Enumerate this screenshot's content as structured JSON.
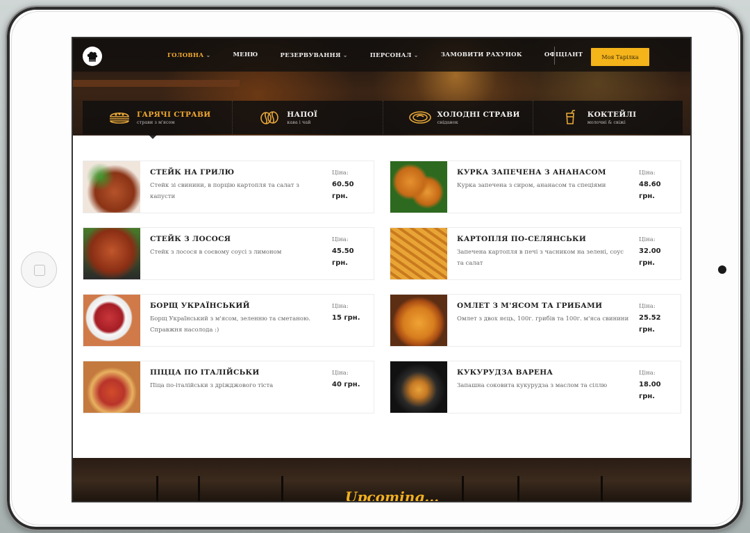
{
  "nav": {
    "items": [
      {
        "label": "ГОЛОВНА",
        "caret": "⌄",
        "active": true
      },
      {
        "label": "МЕНЮ",
        "caret": "",
        "active": false
      },
      {
        "label": "РЕЗЕРВУВАННЯ",
        "caret": "⌄",
        "active": false
      },
      {
        "label": "ПЕРСОНАЛ",
        "caret": "⌄",
        "active": false
      },
      {
        "label": "ЗАМОВИТИ РАХУНОК",
        "caret": "",
        "active": false
      },
      {
        "label": "ОФІЦІАНТ",
        "caret": "",
        "active": false
      }
    ],
    "cta_label": "Моя Тарілка",
    "logo_icon": "chef-hat-icon"
  },
  "categories": [
    {
      "title": "ГАРЯЧІ СТРАВИ",
      "subtitle": "страви з м'ясом",
      "icon": "burger-icon",
      "active": true
    },
    {
      "title": "НАПОЇ",
      "subtitle": "кава і чай",
      "icon": "coffee-beans-icon",
      "active": false
    },
    {
      "title": "ХОЛОДНІ СТРАВИ",
      "subtitle": "сніданок",
      "icon": "salad-bowl-icon",
      "active": false
    },
    {
      "title": "КОКТЕЙЛІ",
      "subtitle": "молочні & свіжі",
      "icon": "cocktail-icon",
      "active": false
    }
  ],
  "menu": {
    "price_label": "Ціна:",
    "items": [
      {
        "title": "СТЕЙК НА ГРИЛЮ",
        "desc": "Стейк зі свинини, в порцію картопля та салат з капусти",
        "price": "60.50",
        "currency": "грн.",
        "image": "steak"
      },
      {
        "title": "КУРКА ЗАПЕЧЕНА З АНАНАСОМ",
        "desc": "Курка запечена з сиром, ананасом та спеціями",
        "price": "48.60",
        "currency": "грн.",
        "image": "chicken"
      },
      {
        "title": "СТЕЙК З ЛОСОСЯ",
        "desc": "Стейк з лосося в соєвому соусі з лимоном",
        "price": "45.50",
        "currency": "грн.",
        "image": "salmon"
      },
      {
        "title": "КАРТОПЛЯ ПО-СЕЛЯНСЬКИ",
        "desc": "Запечена картопля в печі з часником на зелені, соус та салат",
        "price": "32.00",
        "currency": "грн.",
        "image": "potato"
      },
      {
        "title": "БОРЩ УКРАЇНСЬКИЙ",
        "desc": "Борщ Український з м'ясом, зеленню та сметаною. Справжня насолода :)",
        "price": "15",
        "currency": "грн.",
        "image": "borsch"
      },
      {
        "title": "ОМЛЕТ З М'ЯСОМ ТА ГРИБАМИ",
        "desc": "Омлет з двох яєць, 100г. грибів та 100г. м'яса свинини",
        "price": "25.52",
        "currency": "грн.",
        "image": "omelet"
      },
      {
        "title": "ПІЦЦА ПО ІТАЛІЙСЬКИ",
        "desc": "Піца по-італійськи з дріжджового тіста",
        "price": "40",
        "currency": "грн.",
        "image": "pizza"
      },
      {
        "title": "КУКУРУДЗА ВАРЕНА",
        "desc": "Запашна соковита кукурудза з маслом та сіллю",
        "price": "18.00",
        "currency": "грн.",
        "image": "corn"
      }
    ]
  },
  "footer": {
    "script_text": "Upcoming..."
  }
}
